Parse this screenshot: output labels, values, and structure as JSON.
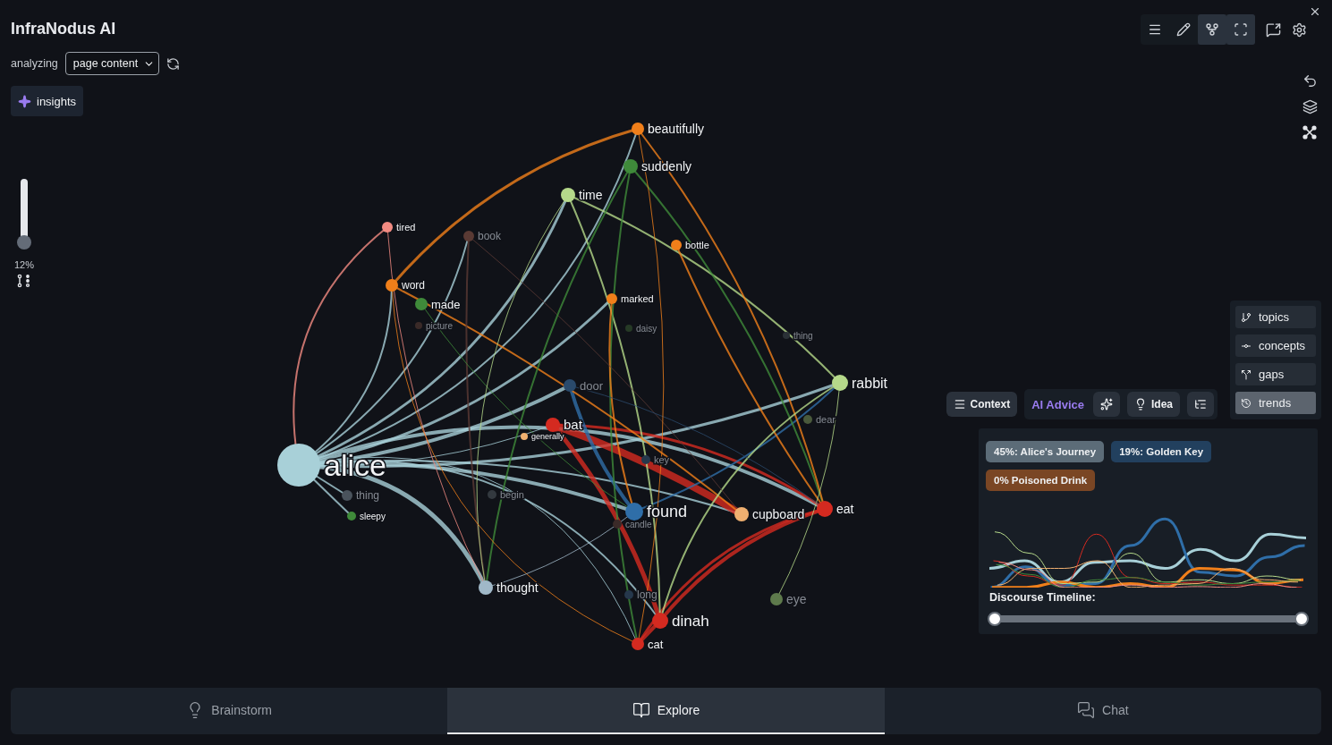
{
  "app": {
    "title": "InfraNodus AI",
    "analyzing_label": "analyzing",
    "source_select": {
      "value": "page content"
    },
    "insights_button": "insights"
  },
  "toolbar": [
    {
      "kind": "menu",
      "selected": false
    },
    {
      "kind": "edit",
      "selected": false
    },
    {
      "kind": "graph",
      "selected": true
    },
    {
      "kind": "fullscreen",
      "selected": true
    }
  ],
  "zoom_slider": {
    "level": 0.12,
    "reading": "12%"
  },
  "graph": {
    "nodes": [
      {
        "label": "beautifully",
        "color": "#f07f1a",
        "dimmed": false
      },
      {
        "label": "suddenly",
        "color": "#3f8a3a",
        "dimmed": false
      },
      {
        "label": "time",
        "color": "#b5d98a",
        "dimmed": false
      },
      {
        "label": "tired",
        "color": "#f28b82",
        "dimmed": false
      },
      {
        "label": "book",
        "color": "#5a3a34",
        "dimmed": true
      },
      {
        "label": "bottle",
        "color": "#f07f1a",
        "dimmed": false
      },
      {
        "label": "word",
        "color": "#f07f1a",
        "dimmed": false
      },
      {
        "label": "made",
        "color": "#3f8a3a",
        "dimmed": false
      },
      {
        "label": "marked",
        "color": "#f07f1a",
        "dimmed": false
      },
      {
        "label": "picture",
        "color": "#3a2a28",
        "dimmed": true
      },
      {
        "label": "daisy",
        "color": "#263a26",
        "dimmed": true
      },
      {
        "label": "thing",
        "color": "#2a3036",
        "dimmed": true
      },
      {
        "label": "rabbit",
        "color": "#b5d98a",
        "dimmed": false
      },
      {
        "label": "door",
        "color": "#2a4a6c",
        "dimmed": true
      },
      {
        "label": "dear",
        "color": "#4a5a3c",
        "dimmed": true
      },
      {
        "label": "bat",
        "color": "#d42a20",
        "dimmed": false
      },
      {
        "label": "generally",
        "color": "#f0b070",
        "dimmed": false
      },
      {
        "label": "alice",
        "color": "#a8d0d8",
        "dimmed": false
      },
      {
        "label": "key",
        "color": "#26384c",
        "dimmed": true
      },
      {
        "label": "thing",
        "color": "#4a535c",
        "dimmed": true
      },
      {
        "label": "begin",
        "color": "#33393f",
        "dimmed": true
      },
      {
        "label": "sleepy",
        "color": "#3f8a3a",
        "dimmed": false
      },
      {
        "label": "found",
        "color": "#2f6ea8",
        "dimmed": false
      },
      {
        "label": "candle",
        "color": "#3a2a28",
        "dimmed": true
      },
      {
        "label": "cupboard",
        "color": "#f0b070",
        "dimmed": false
      },
      {
        "label": "eat",
        "color": "#d42a20",
        "dimmed": false
      },
      {
        "label": "thought",
        "color": "#a0b8c8",
        "dimmed": false
      },
      {
        "label": "long",
        "color": "#26384c",
        "dimmed": true
      },
      {
        "label": "eye",
        "color": "#5e7a4c",
        "dimmed": true
      },
      {
        "label": "dinah",
        "color": "#d42a20",
        "dimmed": false
      },
      {
        "label": "cat",
        "color": "#d42a20",
        "dimmed": false
      }
    ]
  },
  "advice_bar": {
    "context_button": "Context",
    "ai_advice_label": "AI Advice",
    "idea_button": "Idea"
  },
  "modes": [
    {
      "kind": "topics",
      "label": "topics",
      "selected": false
    },
    {
      "kind": "concepts",
      "label": "concepts",
      "selected": false
    },
    {
      "kind": "gaps",
      "label": "gaps",
      "selected": false
    },
    {
      "kind": "trends",
      "label": "trends",
      "selected": true
    }
  ],
  "trends": {
    "topics": [
      {
        "label": "45%: Alice's Journey",
        "color": "#5c6c78"
      },
      {
        "label": "19%: Golden Key",
        "color": "#22405e"
      },
      {
        "label": "0% Poisoned Drink",
        "color": "#7a4624"
      }
    ],
    "timeline_label": "Discourse Timeline:",
    "timeline_slider": {
      "level": 1
    }
  },
  "bottom_tabs": [
    {
      "kind": "brainstorm",
      "label": "Brainstorm",
      "selected": false
    },
    {
      "kind": "explore",
      "label": "Explore",
      "selected": true
    },
    {
      "kind": "chat",
      "label": "Chat",
      "selected": false
    }
  ]
}
